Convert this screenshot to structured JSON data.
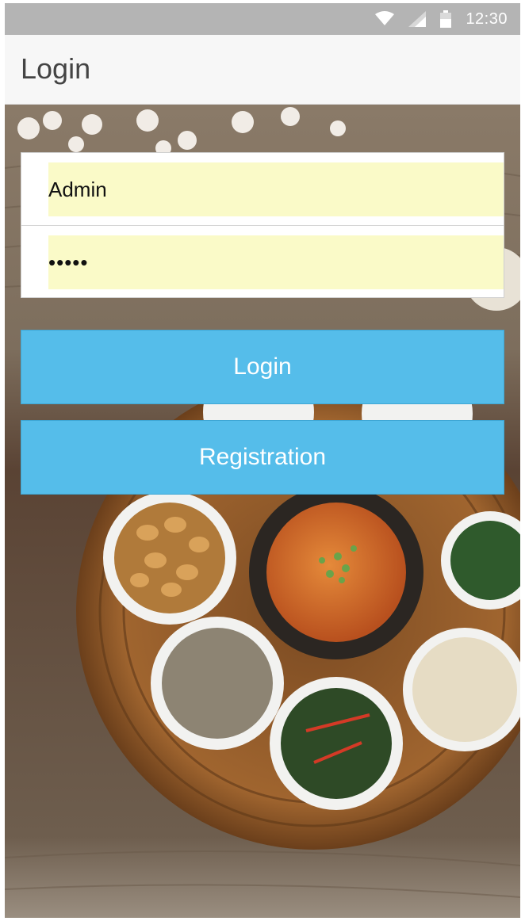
{
  "status_bar": {
    "time": "12:30",
    "icons": [
      "wifi-icon",
      "signal-icon",
      "battery-icon"
    ]
  },
  "app_bar": {
    "title": "Login"
  },
  "form": {
    "username_value": "Admin",
    "password_value": "•••••"
  },
  "buttons": {
    "login_label": "Login",
    "registration_label": "Registration"
  },
  "colors": {
    "status_bar": "#b4b4b4",
    "app_bar": "#f7f7f7",
    "button": "#55bdea",
    "input_fill": "#fafac8"
  },
  "background": "photo of Korean food dishes on a woven tray"
}
